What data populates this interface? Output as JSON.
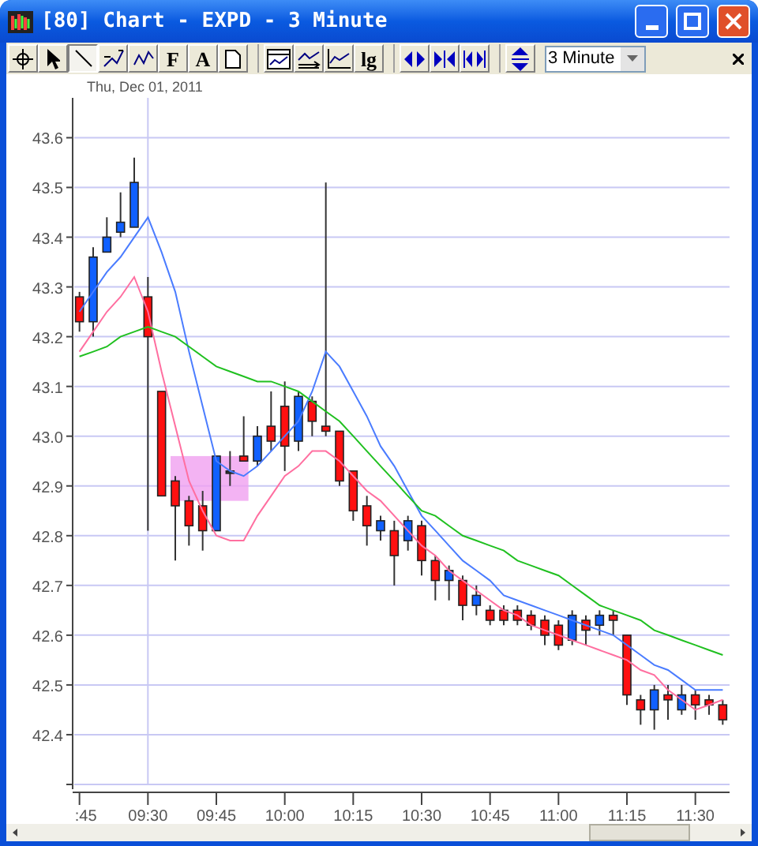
{
  "window": {
    "title": "[80] Chart - EXPD - 3 Minute"
  },
  "toolbar": {
    "groups": [
      [
        {
          "kind": "crosshair",
          "selected": false
        },
        {
          "kind": "pointer",
          "selected": false
        },
        {
          "kind": "line",
          "selected": true
        },
        {
          "kind": "trend",
          "selected": false
        },
        {
          "kind": "wave",
          "selected": false
        },
        {
          "kind": "text",
          "label": "F",
          "selected": false
        },
        {
          "kind": "text",
          "label": "A",
          "selected": false
        },
        {
          "kind": "page",
          "selected": false
        }
      ],
      [
        {
          "kind": "chart",
          "selected": false
        },
        {
          "kind": "indicator",
          "selected": false
        },
        {
          "kind": "study",
          "selected": false
        },
        {
          "kind": "text",
          "label": "lg",
          "selected": false
        }
      ],
      [
        {
          "kind": "expand",
          "selected": false
        },
        {
          "kind": "compress",
          "selected": false
        },
        {
          "kind": "fit",
          "selected": false
        }
      ],
      [
        {
          "kind": "vscale",
          "selected": false
        }
      ]
    ],
    "interval": {
      "value": "3 Minute"
    }
  },
  "chart": {
    "date": "Thu, Dec 01, 2011",
    "chart_data": {
      "type": "candlestick",
      "grid": true,
      "ylim": [
        42.3,
        43.68
      ],
      "categories": [
        ":45",
        null,
        null,
        null,
        null,
        "09:30",
        null,
        null,
        null,
        null,
        "09:45",
        null,
        null,
        null,
        null,
        "10:00",
        null,
        null,
        null,
        null,
        "10:15",
        null,
        null,
        null,
        null,
        "10:30",
        null,
        null,
        null,
        null,
        "10:45",
        null,
        null,
        null,
        null,
        "11:00",
        null,
        null,
        null,
        null,
        "11:15",
        null,
        null,
        null,
        null,
        "11:30",
        null,
        null
      ],
      "ohlc": [
        [
          43.28,
          43.29,
          43.21,
          43.23
        ],
        [
          43.23,
          43.38,
          43.2,
          43.36
        ],
        [
          43.37,
          43.44,
          43.37,
          43.4
        ],
        [
          43.41,
          43.49,
          43.4,
          43.43
        ],
        [
          43.42,
          43.56,
          43.42,
          43.51
        ],
        [
          43.28,
          43.32,
          42.81,
          43.2
        ],
        [
          43.09,
          43.09,
          42.88,
          42.88
        ],
        [
          42.91,
          42.92,
          42.75,
          42.86
        ],
        [
          42.87,
          42.88,
          42.78,
          42.82
        ],
        [
          42.86,
          42.89,
          42.77,
          42.81
        ],
        [
          42.81,
          42.96,
          42.81,
          42.96
        ],
        [
          42.93,
          42.97,
          42.9,
          42.93
        ],
        [
          42.96,
          43.04,
          42.95,
          42.95
        ],
        [
          42.95,
          43.02,
          42.94,
          43.0
        ],
        [
          43.02,
          43.09,
          42.97,
          42.99
        ],
        [
          43.06,
          43.11,
          42.93,
          42.98
        ],
        [
          42.99,
          43.09,
          42.97,
          43.08
        ],
        [
          43.07,
          43.08,
          43.0,
          43.03
        ],
        [
          43.02,
          43.51,
          43.0,
          43.01
        ],
        [
          43.01,
          43.01,
          42.9,
          42.91
        ],
        [
          42.93,
          42.93,
          42.83,
          42.85
        ],
        [
          42.86,
          42.88,
          42.78,
          42.82
        ],
        [
          42.81,
          42.84,
          42.79,
          42.83
        ],
        [
          42.81,
          42.83,
          42.7,
          42.76
        ],
        [
          42.79,
          42.84,
          42.77,
          42.83
        ],
        [
          42.82,
          42.83,
          42.72,
          42.75
        ],
        [
          42.75,
          42.76,
          42.67,
          42.71
        ],
        [
          42.71,
          42.74,
          42.67,
          42.73
        ],
        [
          42.71,
          42.72,
          42.63,
          42.66
        ],
        [
          42.66,
          42.7,
          42.64,
          42.68
        ],
        [
          42.65,
          42.66,
          42.62,
          42.63
        ],
        [
          42.65,
          42.66,
          42.62,
          42.63
        ],
        [
          42.65,
          42.66,
          42.62,
          42.63
        ],
        [
          42.64,
          42.65,
          42.61,
          42.62
        ],
        [
          42.63,
          42.64,
          42.58,
          42.6
        ],
        [
          42.62,
          42.63,
          42.57,
          42.58
        ],
        [
          42.59,
          42.65,
          42.58,
          42.64
        ],
        [
          42.63,
          42.64,
          42.58,
          42.61
        ],
        [
          42.62,
          42.65,
          42.6,
          42.64
        ],
        [
          42.64,
          42.65,
          42.6,
          42.63
        ],
        [
          42.6,
          42.6,
          42.46,
          42.48
        ],
        [
          42.47,
          42.48,
          42.42,
          42.45
        ],
        [
          42.45,
          42.5,
          42.41,
          42.49
        ],
        [
          42.48,
          42.5,
          42.43,
          42.47
        ],
        [
          42.45,
          42.5,
          42.44,
          42.48
        ],
        [
          42.48,
          42.49,
          42.43,
          42.46
        ],
        [
          42.47,
          42.48,
          42.44,
          42.46
        ],
        [
          42.46,
          42.47,
          42.42,
          42.43
        ]
      ],
      "series": [
        {
          "type": "line",
          "color": "#4a7cff",
          "values": [
            43.25,
            43.29,
            43.33,
            43.36,
            43.4,
            43.44,
            43.37,
            43.29,
            43.17,
            43.06,
            42.95,
            42.93,
            42.92,
            42.94,
            42.97,
            43.0,
            43.03,
            43.09,
            43.17,
            43.14,
            43.09,
            43.04,
            42.98,
            42.94,
            42.89,
            42.84,
            42.81,
            42.78,
            42.75,
            42.73,
            42.71,
            42.68,
            42.67,
            42.66,
            42.65,
            42.64,
            42.63,
            42.62,
            42.61,
            42.6,
            42.58,
            42.56,
            42.54,
            42.53,
            42.51,
            42.49,
            42.49,
            42.49
          ]
        },
        {
          "type": "line",
          "color": "#ff6fa0",
          "values": [
            43.17,
            43.21,
            43.25,
            43.28,
            43.32,
            43.25,
            43.13,
            43.02,
            42.91,
            42.85,
            42.8,
            42.79,
            42.79,
            42.84,
            42.88,
            42.92,
            42.94,
            42.97,
            42.97,
            42.95,
            42.92,
            42.89,
            42.87,
            42.84,
            42.81,
            42.78,
            42.76,
            42.73,
            42.71,
            42.69,
            42.67,
            42.65,
            42.64,
            42.62,
            42.61,
            42.6,
            42.59,
            42.58,
            42.57,
            42.56,
            42.55,
            42.53,
            42.52,
            42.49,
            42.47,
            42.45,
            42.46,
            42.47
          ]
        },
        {
          "type": "line",
          "color": "#20c020",
          "values": [
            43.16,
            43.17,
            43.18,
            43.2,
            43.21,
            43.22,
            43.21,
            43.2,
            43.18,
            43.16,
            43.14,
            43.13,
            43.12,
            43.11,
            43.11,
            43.1,
            43.09,
            43.07,
            43.05,
            43.03,
            43.0,
            42.97,
            42.94,
            42.91,
            42.88,
            42.85,
            42.84,
            42.82,
            42.8,
            42.79,
            42.78,
            42.77,
            42.75,
            42.74,
            42.73,
            42.72,
            42.7,
            42.68,
            42.66,
            42.65,
            42.64,
            42.63,
            42.61,
            42.6,
            42.59,
            42.58,
            42.57,
            42.56
          ]
        }
      ],
      "yticks": [
        {
          "value": 42.4,
          "label": "42.4"
        },
        {
          "value": 42.5,
          "label": "42.5"
        },
        {
          "value": 42.6,
          "label": "42.6"
        },
        {
          "value": 42.7,
          "label": "42.7"
        },
        {
          "value": 42.8,
          "label": "42.8"
        },
        {
          "value": 42.9,
          "label": "42.9"
        },
        {
          "value": 43.0,
          "label": "43.0"
        },
        {
          "value": 43.1,
          "label": "43.1"
        },
        {
          "value": 43.2,
          "label": "43.2"
        },
        {
          "value": 43.3,
          "label": "43.3"
        },
        {
          "value": 43.4,
          "label": "43.4"
        },
        {
          "value": 43.5,
          "label": "43.5"
        },
        {
          "value": 43.6,
          "label": "43.6"
        }
      ]
    }
  }
}
